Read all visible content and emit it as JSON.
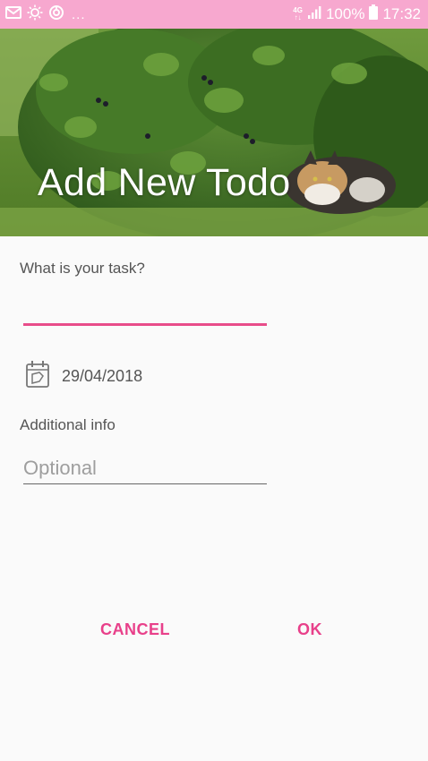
{
  "status_bar": {
    "dots": "...",
    "network_top": "4G",
    "network_bottom": "↑↓",
    "battery": "100%",
    "time": "17:32",
    "background_color": "#f7a8cf"
  },
  "header": {
    "title": "Add New Todo"
  },
  "form": {
    "task_label": "What is your task?",
    "task_value": "",
    "date": "29/04/2018",
    "info_label": "Additional info",
    "info_placeholder": "Optional",
    "info_value": ""
  },
  "actions": {
    "cancel_label": "CANCEL",
    "ok_label": "OK",
    "accent_color": "#e8408a"
  },
  "icons": [
    "mail-icon",
    "sun-icon",
    "sync-icon",
    "signal-icon",
    "battery-icon",
    "calendar-icon"
  ]
}
